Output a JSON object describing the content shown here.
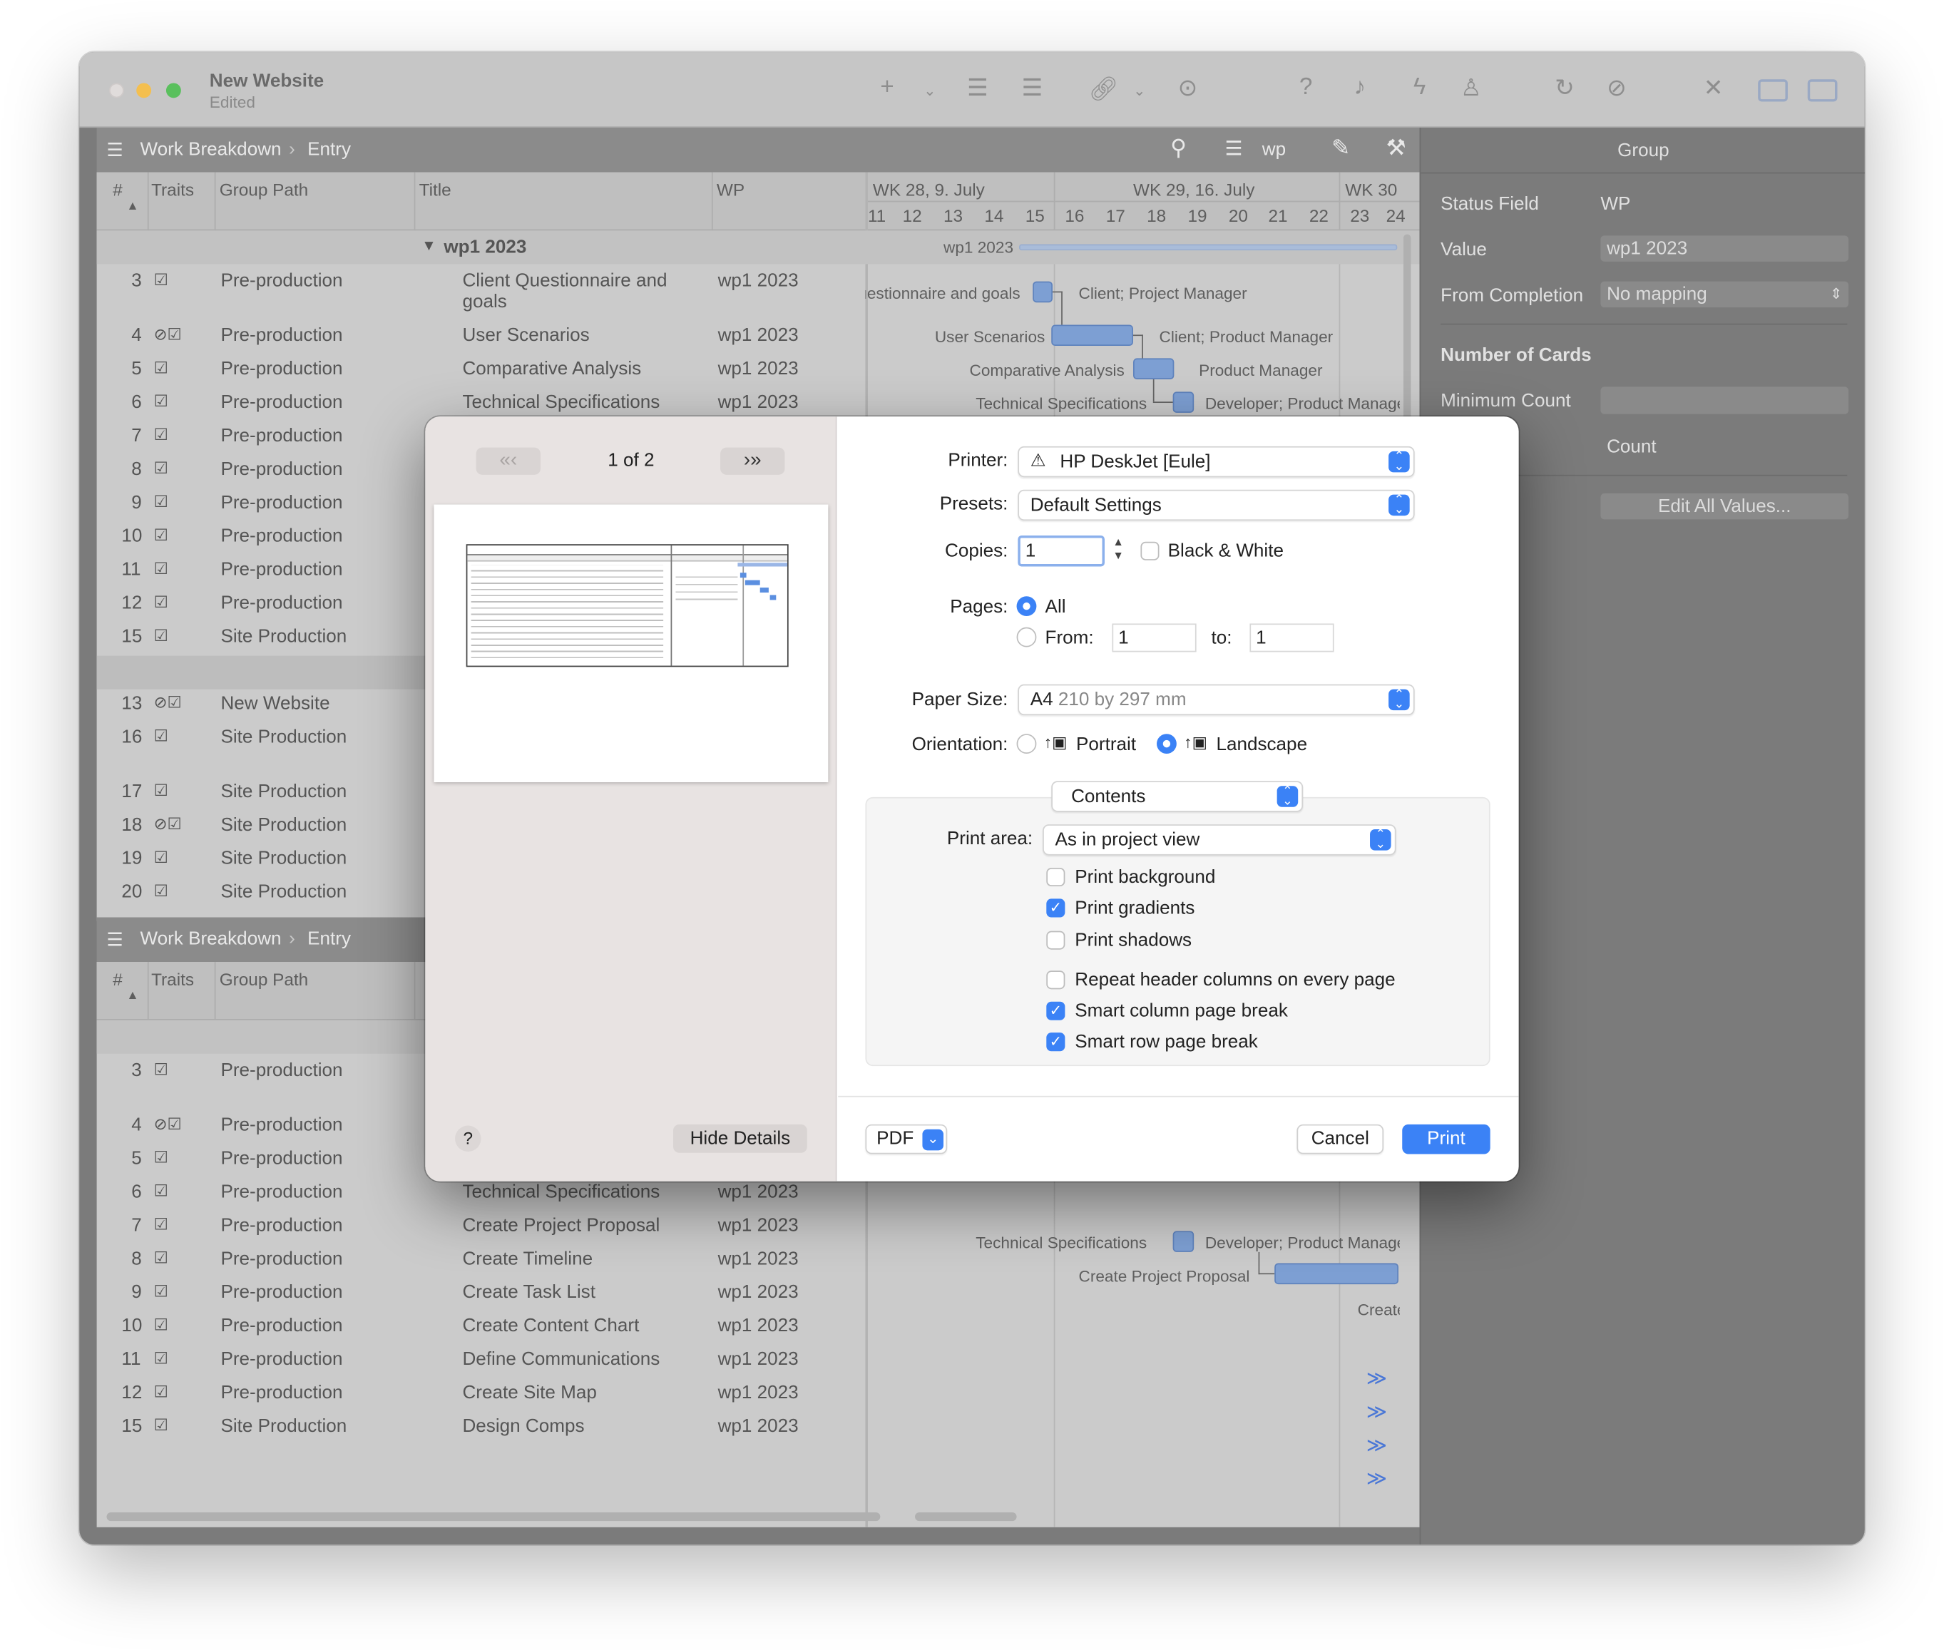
{
  "window": {
    "title": "New Website",
    "subtitle": "Edited"
  },
  "views": [
    {
      "breadcrumb_root": "Work Breakdown",
      "breadcrumb_leaf": "Entry"
    },
    {
      "breadcrumb_root": "Work Breakdown",
      "breadcrumb_leaf": "Entry"
    }
  ],
  "toolbar2": {
    "wp_label": "wp"
  },
  "columns": {
    "num": "#",
    "traits": "Traits",
    "group_path": "Group Path",
    "title": "Title",
    "wp": "WP"
  },
  "gantt": {
    "weeks": [
      "WK 28, 9. July",
      "WK 29, 16. July",
      "WK 30"
    ],
    "days": [
      "11",
      "12",
      "13",
      "14",
      "15",
      "16",
      "17",
      "18",
      "19",
      "20",
      "21",
      "22",
      "23",
      "24"
    ],
    "group_bar_label": "wp1 2023",
    "labels_top": [
      {
        "left": "Client Questionnaire and goals",
        "right": "Client; Project Manager"
      },
      {
        "left": "User Scenarios",
        "right": "Client; Product Manager"
      },
      {
        "left": "Comparative Analysis",
        "right": "Product Manager"
      },
      {
        "left": "Technical Specifications",
        "right": "Developer; Product Manager"
      }
    ],
    "labels_bottom": [
      {
        "left": "Technical Specifications",
        "right": "Developer; Product Manager"
      },
      {
        "left": "Create Project Proposal",
        "right": ""
      },
      {
        "left": "",
        "right": "Create"
      }
    ]
  },
  "group": {
    "title": "wp1 2023"
  },
  "rows_top": [
    {
      "num": "3",
      "group": "Pre-production",
      "title": "Client Questionnaire and",
      "title2": "goals",
      "wp": "wp1 2023"
    },
    {
      "num": "4",
      "group": "Pre-production",
      "title": "User Scenarios",
      "title2": "",
      "wp": "wp1 2023"
    },
    {
      "num": "5",
      "group": "Pre-production",
      "title": "Comparative Analysis",
      "title2": "",
      "wp": "wp1 2023"
    },
    {
      "num": "6",
      "group": "Pre-production",
      "title": "Technical Specifications",
      "title2": "",
      "wp": "wp1 2023"
    },
    {
      "num": "7",
      "group": "Pre-production"
    },
    {
      "num": "8",
      "group": "Pre-production"
    },
    {
      "num": "9",
      "group": "Pre-production"
    },
    {
      "num": "10",
      "group": "Pre-production"
    },
    {
      "num": "11",
      "group": "Pre-production"
    },
    {
      "num": "12",
      "group": "Pre-production"
    },
    {
      "num": "15",
      "group": "Site Production"
    },
    {
      "num": "13",
      "group": "New Website"
    },
    {
      "num": "16",
      "group": "Site Production"
    },
    {
      "num": "17",
      "group": "Site Production"
    },
    {
      "num": "18",
      "group": "Site Production"
    },
    {
      "num": "19",
      "group": "Site Production"
    },
    {
      "num": "20",
      "group": "Site Production"
    }
  ],
  "rows_bottom": [
    {
      "num": "3",
      "group": "Pre-production",
      "title": "",
      "wp": ""
    },
    {
      "num": "4",
      "group": "Pre-production",
      "title": "",
      "wp": ""
    },
    {
      "num": "5",
      "group": "Pre-production",
      "title": "",
      "wp": ""
    },
    {
      "num": "6",
      "group": "Pre-production",
      "title": "Technical Specifications",
      "wp": "wp1 2023"
    },
    {
      "num": "7",
      "group": "Pre-production",
      "title": "Create Project Proposal",
      "wp": "wp1 2023"
    },
    {
      "num": "8",
      "group": "Pre-production",
      "title": "Create Timeline",
      "wp": "wp1 2023"
    },
    {
      "num": "9",
      "group": "Pre-production",
      "title": "Create Task List",
      "wp": "wp1 2023"
    },
    {
      "num": "10",
      "group": "Pre-production",
      "title": "Create Content Chart",
      "wp": "wp1 2023"
    },
    {
      "num": "11",
      "group": "Pre-production",
      "title": "Define Communications",
      "wp": "wp1 2023"
    },
    {
      "num": "12",
      "group": "Pre-production",
      "title": "Create Site Map",
      "wp": "wp1 2023"
    },
    {
      "num": "15",
      "group": "Site Production",
      "title": "Design Comps",
      "wp": "wp1 2023"
    }
  ],
  "more_glyph": "≫",
  "inspector": {
    "title": "Group",
    "status_field_label": "Status Field",
    "status_field_value": "WP",
    "value_label": "Value",
    "value_value": "wp1 2023",
    "from_completion_label": "From Completion",
    "from_completion_value": "No mapping",
    "cards_heading": "Number of Cards",
    "min_label": "Minimum Count",
    "max_label": "Count",
    "edit_button": "Edit All Values..."
  },
  "dialog": {
    "page_indicator": "1 of 2",
    "hide_details": "Hide Details",
    "help": "?",
    "printer_label": "Printer:",
    "printer_value": "HP DeskJet [Eule]",
    "presets_label": "Presets:",
    "presets_value": "Default Settings",
    "copies_label": "Copies:",
    "copies_value": "1",
    "bw_label": "Black & White",
    "pages_label": "Pages:",
    "pages_all": "All",
    "pages_from": "From:",
    "pages_from_value": "1",
    "pages_to": "to:",
    "pages_to_value": "1",
    "paper_label": "Paper Size:",
    "paper_value": "A4",
    "paper_detail": "210 by 297 mm",
    "orientation_label": "Orientation:",
    "portrait": "Portrait",
    "landscape": "Landscape",
    "section": "Contents",
    "print_area_label": "Print area:",
    "print_area_value": "As in project view",
    "options": [
      {
        "label": "Print background",
        "checked": false
      },
      {
        "label": "Print gradients",
        "checked": true
      },
      {
        "label": "Print shadows",
        "checked": false
      },
      {
        "label": "Repeat header columns on every page",
        "checked": false
      },
      {
        "label": "Smart column page break",
        "checked": true
      },
      {
        "label": "Smart row page break",
        "checked": true
      }
    ],
    "pdf": "PDF",
    "cancel": "Cancel",
    "print": "Print"
  },
  "colors": {
    "accent": "#3b82f6",
    "bar": "#7d9fd3"
  }
}
